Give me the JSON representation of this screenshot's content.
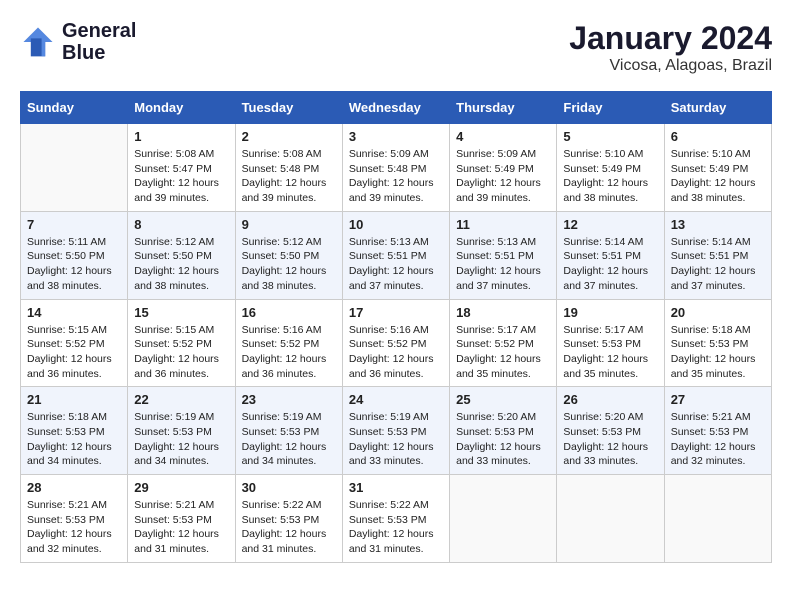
{
  "logo": {
    "line1": "General",
    "line2": "Blue"
  },
  "title": "January 2024",
  "location": "Vicosa, Alagoas, Brazil",
  "days_of_week": [
    "Sunday",
    "Monday",
    "Tuesday",
    "Wednesday",
    "Thursday",
    "Friday",
    "Saturday"
  ],
  "weeks": [
    [
      {
        "day": "",
        "info": ""
      },
      {
        "day": "1",
        "info": "Sunrise: 5:08 AM\nSunset: 5:47 PM\nDaylight: 12 hours\nand 39 minutes."
      },
      {
        "day": "2",
        "info": "Sunrise: 5:08 AM\nSunset: 5:48 PM\nDaylight: 12 hours\nand 39 minutes."
      },
      {
        "day": "3",
        "info": "Sunrise: 5:09 AM\nSunset: 5:48 PM\nDaylight: 12 hours\nand 39 minutes."
      },
      {
        "day": "4",
        "info": "Sunrise: 5:09 AM\nSunset: 5:49 PM\nDaylight: 12 hours\nand 39 minutes."
      },
      {
        "day": "5",
        "info": "Sunrise: 5:10 AM\nSunset: 5:49 PM\nDaylight: 12 hours\nand 38 minutes."
      },
      {
        "day": "6",
        "info": "Sunrise: 5:10 AM\nSunset: 5:49 PM\nDaylight: 12 hours\nand 38 minutes."
      }
    ],
    [
      {
        "day": "7",
        "info": "Sunrise: 5:11 AM\nSunset: 5:50 PM\nDaylight: 12 hours\nand 38 minutes."
      },
      {
        "day": "8",
        "info": "Sunrise: 5:12 AM\nSunset: 5:50 PM\nDaylight: 12 hours\nand 38 minutes."
      },
      {
        "day": "9",
        "info": "Sunrise: 5:12 AM\nSunset: 5:50 PM\nDaylight: 12 hours\nand 38 minutes."
      },
      {
        "day": "10",
        "info": "Sunrise: 5:13 AM\nSunset: 5:51 PM\nDaylight: 12 hours\nand 37 minutes."
      },
      {
        "day": "11",
        "info": "Sunrise: 5:13 AM\nSunset: 5:51 PM\nDaylight: 12 hours\nand 37 minutes."
      },
      {
        "day": "12",
        "info": "Sunrise: 5:14 AM\nSunset: 5:51 PM\nDaylight: 12 hours\nand 37 minutes."
      },
      {
        "day": "13",
        "info": "Sunrise: 5:14 AM\nSunset: 5:51 PM\nDaylight: 12 hours\nand 37 minutes."
      }
    ],
    [
      {
        "day": "14",
        "info": "Sunrise: 5:15 AM\nSunset: 5:52 PM\nDaylight: 12 hours\nand 36 minutes."
      },
      {
        "day": "15",
        "info": "Sunrise: 5:15 AM\nSunset: 5:52 PM\nDaylight: 12 hours\nand 36 minutes."
      },
      {
        "day": "16",
        "info": "Sunrise: 5:16 AM\nSunset: 5:52 PM\nDaylight: 12 hours\nand 36 minutes."
      },
      {
        "day": "17",
        "info": "Sunrise: 5:16 AM\nSunset: 5:52 PM\nDaylight: 12 hours\nand 36 minutes."
      },
      {
        "day": "18",
        "info": "Sunrise: 5:17 AM\nSunset: 5:52 PM\nDaylight: 12 hours\nand 35 minutes."
      },
      {
        "day": "19",
        "info": "Sunrise: 5:17 AM\nSunset: 5:53 PM\nDaylight: 12 hours\nand 35 minutes."
      },
      {
        "day": "20",
        "info": "Sunrise: 5:18 AM\nSunset: 5:53 PM\nDaylight: 12 hours\nand 35 minutes."
      }
    ],
    [
      {
        "day": "21",
        "info": "Sunrise: 5:18 AM\nSunset: 5:53 PM\nDaylight: 12 hours\nand 34 minutes."
      },
      {
        "day": "22",
        "info": "Sunrise: 5:19 AM\nSunset: 5:53 PM\nDaylight: 12 hours\nand 34 minutes."
      },
      {
        "day": "23",
        "info": "Sunrise: 5:19 AM\nSunset: 5:53 PM\nDaylight: 12 hours\nand 34 minutes."
      },
      {
        "day": "24",
        "info": "Sunrise: 5:19 AM\nSunset: 5:53 PM\nDaylight: 12 hours\nand 33 minutes."
      },
      {
        "day": "25",
        "info": "Sunrise: 5:20 AM\nSunset: 5:53 PM\nDaylight: 12 hours\nand 33 minutes."
      },
      {
        "day": "26",
        "info": "Sunrise: 5:20 AM\nSunset: 5:53 PM\nDaylight: 12 hours\nand 33 minutes."
      },
      {
        "day": "27",
        "info": "Sunrise: 5:21 AM\nSunset: 5:53 PM\nDaylight: 12 hours\nand 32 minutes."
      }
    ],
    [
      {
        "day": "28",
        "info": "Sunrise: 5:21 AM\nSunset: 5:53 PM\nDaylight: 12 hours\nand 32 minutes."
      },
      {
        "day": "29",
        "info": "Sunrise: 5:21 AM\nSunset: 5:53 PM\nDaylight: 12 hours\nand 31 minutes."
      },
      {
        "day": "30",
        "info": "Sunrise: 5:22 AM\nSunset: 5:53 PM\nDaylight: 12 hours\nand 31 minutes."
      },
      {
        "day": "31",
        "info": "Sunrise: 5:22 AM\nSunset: 5:53 PM\nDaylight: 12 hours\nand 31 minutes."
      },
      {
        "day": "",
        "info": ""
      },
      {
        "day": "",
        "info": ""
      },
      {
        "day": "",
        "info": ""
      }
    ]
  ]
}
